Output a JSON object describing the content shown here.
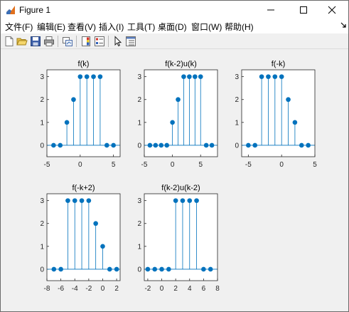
{
  "window": {
    "title": "Figure 1",
    "icon": "matlab-figure-icon",
    "controls": {
      "minimize": "minimize-icon",
      "maximize": "maximize-icon",
      "close": "close-icon"
    }
  },
  "menubar": {
    "items": [
      {
        "label": "文件(F)"
      },
      {
        "label": "编辑(E)"
      },
      {
        "label": "查看(V)"
      },
      {
        "label": "插入(I)"
      },
      {
        "label": "工具(T)"
      },
      {
        "label": "桌面(D)"
      },
      {
        "label": "窗口(W)"
      },
      {
        "label": "帮助(H)"
      }
    ]
  },
  "toolbar": {
    "icons": [
      "new-figure-icon",
      "open-file-icon",
      "save-icon",
      "print-icon",
      "link-plot-icon",
      "insert-colorbar-icon",
      "insert-legend-icon",
      "edit-plot-arrow-icon",
      "property-inspector-icon"
    ]
  },
  "colors": {
    "stem": "#0072BD",
    "axes": "#262626"
  },
  "chart_data": [
    {
      "type": "stem",
      "title": "f(k)",
      "xlim": [
        -5,
        6
      ],
      "ylim": [
        -0.5,
        3.3
      ],
      "xticks": [
        -5,
        0,
        5
      ],
      "yticks": [
        0,
        1,
        2,
        3
      ],
      "x": [
        -4,
        -3,
        -2,
        -1,
        0,
        1,
        2,
        3,
        4,
        5
      ],
      "y": [
        0,
        0,
        1,
        2,
        3,
        3,
        3,
        3,
        0,
        0
      ]
    },
    {
      "type": "stem",
      "title": "f(k-2)u(k)",
      "xlim": [
        -5,
        8
      ],
      "ylim": [
        -0.5,
        3.3
      ],
      "xticks": [
        -5,
        0,
        5
      ],
      "yticks": [
        0,
        1,
        2,
        3
      ],
      "x": [
        -4,
        -3,
        -2,
        -1,
        0,
        1,
        2,
        3,
        4,
        5,
        6,
        7
      ],
      "y": [
        0,
        0,
        0,
        0,
        1,
        2,
        3,
        3,
        3,
        3,
        0,
        0
      ]
    },
    {
      "type": "stem",
      "title": "f(-k)",
      "xlim": [
        -6,
        5
      ],
      "ylim": [
        -0.5,
        3.3
      ],
      "xticks": [
        -5,
        0,
        5
      ],
      "yticks": [
        0,
        1,
        2,
        3
      ],
      "x": [
        -5,
        -4,
        -3,
        -2,
        -1,
        0,
        1,
        2,
        3,
        4
      ],
      "y": [
        0,
        0,
        3,
        3,
        3,
        3,
        2,
        1,
        0,
        0
      ]
    },
    {
      "type": "stem",
      "title": "f(-k+2)",
      "xlim": [
        -8,
        2.5
      ],
      "ylim": [
        -0.5,
        3.3
      ],
      "xticks": [
        -8,
        -6,
        -4,
        -2,
        0,
        2
      ],
      "yticks": [
        0,
        1,
        2,
        3
      ],
      "x": [
        -7,
        -6,
        -5,
        -4,
        -3,
        -2,
        -1,
        0,
        1,
        2
      ],
      "y": [
        0,
        0,
        3,
        3,
        3,
        3,
        2,
        1,
        0,
        0
      ]
    },
    {
      "type": "stem",
      "title": "f(k-2)u(k-2)",
      "xlim": [
        -2.5,
        8
      ],
      "ylim": [
        -0.5,
        3.3
      ],
      "xticks": [
        -2,
        0,
        2,
        4,
        6,
        8
      ],
      "yticks": [
        0,
        1,
        2,
        3
      ],
      "x": [
        -2,
        -1,
        0,
        1,
        2,
        3,
        4,
        5,
        6,
        7
      ],
      "y": [
        0,
        0,
        0,
        0,
        3,
        3,
        3,
        3,
        0,
        0
      ]
    }
  ]
}
